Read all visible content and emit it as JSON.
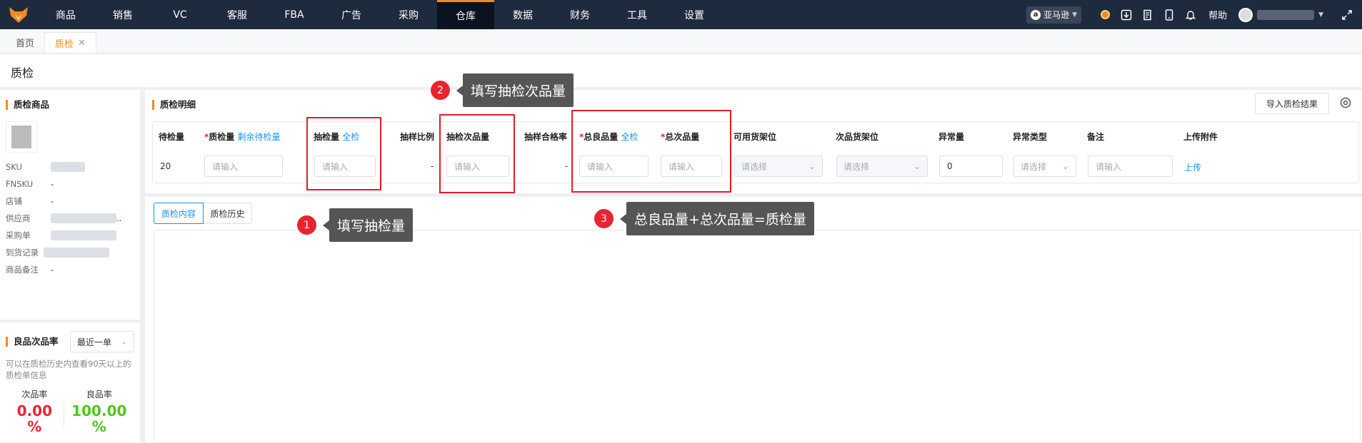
{
  "nav": {
    "items": [
      "商品",
      "销售",
      "VC",
      "客服",
      "FBA",
      "广告",
      "采购",
      "仓库",
      "数据",
      "财务",
      "工具",
      "设置"
    ],
    "active": "仓库",
    "store": "亚马逊",
    "help": "帮助"
  },
  "tabs": {
    "home": "首页",
    "current": "质检"
  },
  "page": {
    "title": "质检"
  },
  "left": {
    "section_title": "质检商品",
    "fields": [
      {
        "label": "SKU",
        "value": ""
      },
      {
        "label": "FNSKU",
        "value": "-"
      },
      {
        "label": "店铺",
        "value": "-"
      },
      {
        "label": "供应商",
        "value": ".."
      },
      {
        "label": "采购单",
        "value": ""
      },
      {
        "label": "到货记录",
        "value": ""
      },
      {
        "label": "商品备注",
        "value": "-"
      }
    ],
    "rate_title": "良品次品率",
    "rate_select": "最近一单",
    "rate_note": "可以在质检历史内查看90天以上的质检单信息",
    "defect_label": "次品率",
    "defect_value": "0.00",
    "good_label": "良品率",
    "good_value": "100.00",
    "percent": "%"
  },
  "detail": {
    "section_title": "质检明细",
    "import_button": "导入质检结果",
    "headers": {
      "pending": "待检量",
      "qc_qty": "质检量",
      "remaining_link": "剩余待检量",
      "sample_qty": "抽检量",
      "full_check": "全检",
      "sample_ratio": "抽样比例",
      "sample_defect": "抽检次品量",
      "pass_rate": "抽样合格率",
      "total_good": "总良品量",
      "total_defect": "总次品量",
      "avail_shelf": "可用货架位",
      "defect_shelf": "次品货架位",
      "abnormal_qty": "异常量",
      "abnormal_type": "异常类型",
      "remark": "备注",
      "attachment": "上传附件"
    },
    "row": {
      "pending": "20",
      "input_placeholder": "请输入",
      "select_placeholder": "请选择",
      "sample_ratio": "-",
      "pass_rate": "-",
      "abnormal_qty": "0",
      "upload": "上传"
    }
  },
  "content_tabs": {
    "content": "质检内容",
    "history": "质检历史"
  },
  "callouts": [
    {
      "num": "1",
      "text": "填写抽检量"
    },
    {
      "num": "2",
      "text": "填写抽检次品量"
    },
    {
      "num": "3",
      "text": "总良品量+总次品量=质检量"
    }
  ],
  "colors": {
    "nav_bg": "#1e2a3e",
    "accent": "#f08c1e",
    "link": "#1890ff",
    "danger": "#e8242f",
    "good": "#52c41a"
  }
}
